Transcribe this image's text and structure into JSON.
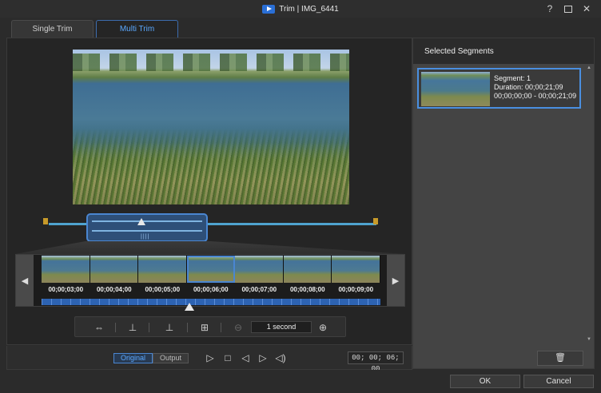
{
  "window": {
    "title": "Trim | IMG_6441",
    "help_label": "?",
    "close_label": "✕"
  },
  "tabs": [
    {
      "label": "Single Trim",
      "active": false
    },
    {
      "label": "Multi Trim",
      "active": true
    }
  ],
  "filmstrip": {
    "timecodes": [
      "00;00;03;00",
      "00;00;04;00",
      "00;00;05;00",
      "00;00;06;00",
      "00;00;07;00",
      "00;00;08;00",
      "00;00;09;00"
    ],
    "selected_index": 3,
    "prev_icon": "◀",
    "next_icon": "▶"
  },
  "toolbar": {
    "zoom_value": "1 second",
    "icons": [
      "swap-arrows-icon",
      "mark-in-icon",
      "mark-out-icon",
      "split-segment-icon",
      "zoom-out-icon",
      "zoom-in-icon"
    ]
  },
  "playback": {
    "original_label": "Original",
    "output_label": "Output",
    "timecode": "00; 00; 06; 00"
  },
  "selected_segments": {
    "heading": "Selected Segments",
    "segments": [
      {
        "line1": "Segment: 1",
        "line2": "Duration: 00;00;21;09",
        "line3": "00;00;00;00 - 00;00;21;09"
      }
    ]
  },
  "footer": {
    "ok_label": "OK",
    "cancel_label": "Cancel"
  },
  "colors": {
    "accent": "#4a86d1",
    "accent_text": "#5aa8ff",
    "marker": "#c79a2a"
  }
}
